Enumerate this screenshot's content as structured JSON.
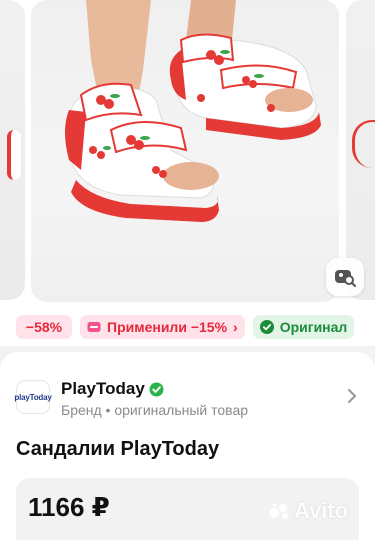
{
  "badges": {
    "discount": "−58%",
    "applied": "Применили −15%",
    "applied_arrow": "›",
    "original": "Оригинал"
  },
  "brand": {
    "logo_text": "playToday",
    "name": "PlayToday",
    "subtitle": "Бренд • оригинальный товар"
  },
  "product": {
    "title": "Сандалии PlayToday",
    "price": "1166 ₽"
  },
  "watermark": "Avito",
  "icons": {
    "lens": "image-search-icon",
    "verified": "verified-check-icon",
    "chevron": "chevron-right-icon",
    "tag": "tag-icon"
  },
  "colors": {
    "discount_bg": "#ffe2ea",
    "discount_text": "#e5283b",
    "original_bg": "#e3f5e6",
    "original_text": "#1a8c3a",
    "sandal_red": "#e53935"
  }
}
